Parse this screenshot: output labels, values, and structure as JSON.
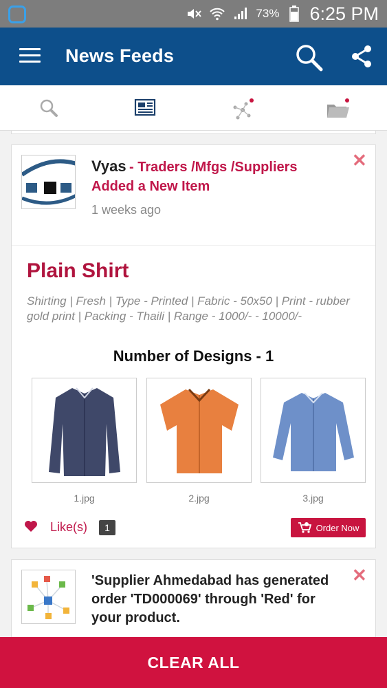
{
  "status_bar": {
    "battery": "73%",
    "time": "6:25 PM"
  },
  "app_bar": {
    "title": "News Feeds"
  },
  "tabs": [
    {
      "icon": "search-icon"
    },
    {
      "icon": "newspaper-icon"
    },
    {
      "icon": "network-icon"
    },
    {
      "icon": "folder-icon"
    }
  ],
  "feed": {
    "item1": {
      "poster": "Vyas",
      "category": "- Traders /Mfgs /Suppliers",
      "action": "Added a New Item",
      "ago": "1 weeks ago",
      "product_title": "Plain Shirt",
      "specs": "Shirting    |  Fresh    |  Type - Printed  |  Fabric - 50x50    |  Print - rubber gold print    |  Packing - Thaili  |  Range - 1000/- - 10000/-",
      "designs_heading": "Number of Designs - 1",
      "designs": [
        {
          "caption": "1.jpg",
          "color": "#3f4869"
        },
        {
          "caption": "2.jpg",
          "color": "#e8803f"
        },
        {
          "caption": "3.jpg",
          "color": "#6e90c9"
        }
      ],
      "likes_label": "Like(s)",
      "likes_count": "1",
      "order_label": "Order Now"
    },
    "item2": {
      "notice": "'Supplier Ahmedabad has generated order 'TD000069' through 'Red' for your product."
    }
  },
  "footer": {
    "clear_all": "CLEAR ALL"
  },
  "colors": {
    "primary": "#0d4f8b",
    "accent": "#c0174a",
    "footer": "#d0123f"
  }
}
